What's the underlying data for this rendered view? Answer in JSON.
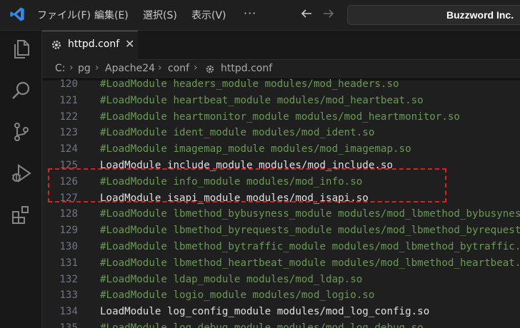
{
  "menu": {
    "file": "ファイル(F)",
    "edit": "編集(E)",
    "selection": "選択(S)",
    "view": "表示(V)",
    "more": "···"
  },
  "search": {
    "text": "Buzzword Inc."
  },
  "tab": {
    "label": "httpd.conf",
    "close": "✕"
  },
  "breadcrumb": {
    "items": [
      "C:",
      "pg",
      "Apache24",
      "conf",
      "httpd.conf"
    ],
    "sep": "›"
  },
  "editor": {
    "lines": [
      {
        "n": "120",
        "text": "#LoadModule headers_module modules/mod_headers.so",
        "comment": true
      },
      {
        "n": "121",
        "text": "#LoadModule heartbeat_module modules/mod_heartbeat.so",
        "comment": true
      },
      {
        "n": "122",
        "text": "#LoadModule heartmonitor_module modules/mod_heartmonitor.so",
        "comment": true
      },
      {
        "n": "123",
        "text": "#LoadModule ident_module modules/mod_ident.so",
        "comment": true
      },
      {
        "n": "124",
        "text": "#LoadModule imagemap_module modules/mod_imagemap.so",
        "comment": true
      },
      {
        "n": "125",
        "text": "LoadModule include_module modules/mod_include.so",
        "comment": false
      },
      {
        "n": "126",
        "text": "#LoadModule info_module modules/mod_info.so",
        "comment": true
      },
      {
        "n": "127",
        "text": "LoadModule isapi_module modules/mod_isapi.so",
        "comment": false
      },
      {
        "n": "128",
        "text": "#LoadModule lbmethod_bybusyness_module modules/mod_lbmethod_bybusyness.so",
        "comment": true
      },
      {
        "n": "129",
        "text": "#LoadModule lbmethod_byrequests_module modules/mod_lbmethod_byrequests.so",
        "comment": true
      },
      {
        "n": "130",
        "text": "#LoadModule lbmethod_bytraffic_module modules/mod_lbmethod_bytraffic.so",
        "comment": true
      },
      {
        "n": "131",
        "text": "#LoadModule lbmethod_heartbeat_module modules/mod_lbmethod_heartbeat.so",
        "comment": true
      },
      {
        "n": "132",
        "text": "#LoadModule ldap_module modules/mod_ldap.so",
        "comment": true
      },
      {
        "n": "133",
        "text": "#LoadModule logio_module modules/mod_logio.so",
        "comment": true
      },
      {
        "n": "134",
        "text": "LoadModule log_config_module modules/mod_log_config.so",
        "comment": false
      },
      {
        "n": "135",
        "text": "#LoadModule log_debug_module modules/mod_log_debug.so",
        "comment": true
      }
    ]
  },
  "colors": {
    "accent": "#0078d4",
    "comment": "#6a9955",
    "highlight": "#e02020"
  }
}
